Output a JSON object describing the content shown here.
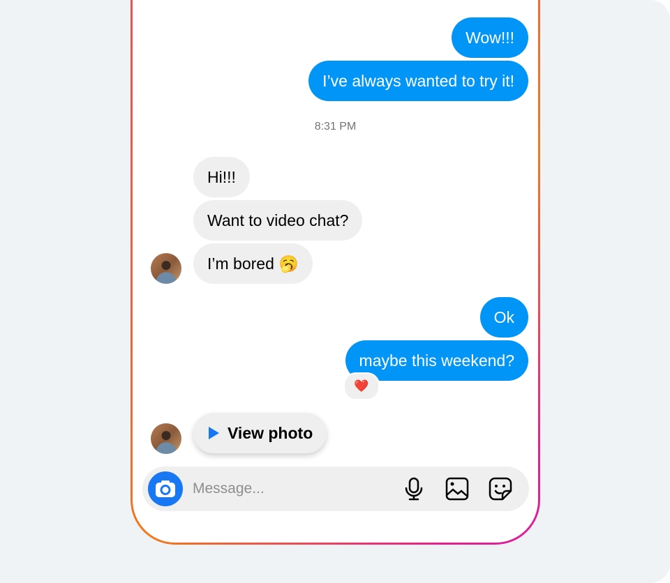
{
  "messages": [
    {
      "from": "me",
      "text": "Wow!!!"
    },
    {
      "from": "me",
      "text": "I’ve always wanted to try it!"
    },
    {
      "from": "them",
      "text": "Hi!!!"
    },
    {
      "from": "them",
      "text": "Want to video chat?"
    },
    {
      "from": "them",
      "text": "I’m bored 🥱"
    },
    {
      "from": "me",
      "text": "Ok"
    },
    {
      "from": "me",
      "text": "maybe this weekend?"
    }
  ],
  "timestamp": "8:31 PM",
  "reaction": "❤️",
  "view_photo_label": "View photo",
  "composer": {
    "placeholder": "Message..."
  },
  "colors": {
    "outgoing": "#0095f6",
    "incoming": "#efefef",
    "accent": "#1877f2"
  }
}
